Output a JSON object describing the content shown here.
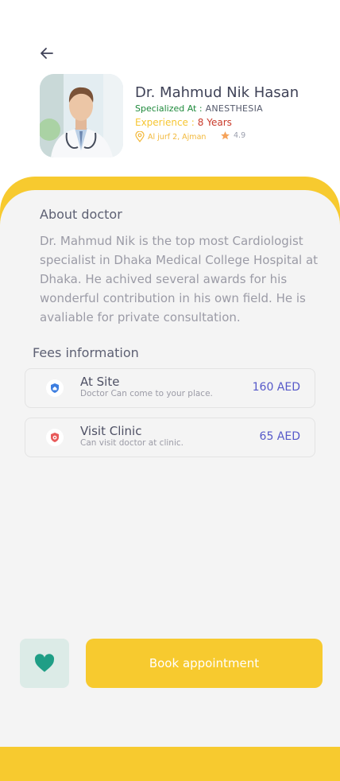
{
  "header": {
    "back_icon": "arrow-left-icon"
  },
  "doctor": {
    "name": "Dr. Mahmud Nik Hasan",
    "specialized_label": "Specialized At :",
    "specialized_value": "ANESTHESIA",
    "experience_label": "Experience :",
    "experience_value": "8 Years",
    "location": "Al jurf 2, Ajman",
    "rating": "4.9"
  },
  "about": {
    "title": "About doctor",
    "text": "Dr. Mahmud Nik is the top most Cardiologist specialist in Dhaka Medical College Hospital at Dhaka. He achived several awards for his wonderful contribution in his own field. He is avaliable for private consultation."
  },
  "fees": {
    "title": "Fees information",
    "items": [
      {
        "title": "At Site",
        "subtitle": "Doctor Can come to your place.",
        "price": "160 AED",
        "icon": "home-shield-icon"
      },
      {
        "title": "Visit Clinic",
        "subtitle": "Can visit doctor at clinic.",
        "price": "65 AED",
        "icon": "clinic-shield-icon"
      }
    ]
  },
  "actions": {
    "favorite_icon": "heart-icon",
    "book_label": "Book appointment"
  },
  "colors": {
    "accent_yellow": "#f7ca2f",
    "price_blue": "#5659c9",
    "favorite_green": "#1f9e86",
    "specialized_green": "#1f8a3c",
    "experience_red": "#c93a2a"
  }
}
